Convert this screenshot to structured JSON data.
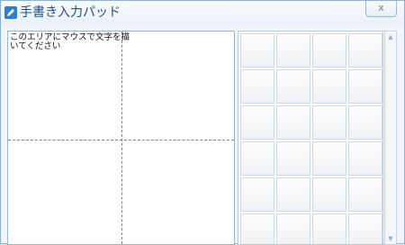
{
  "window": {
    "title": "手書き入力パッド",
    "close_label": "x",
    "icon": "pen-icon"
  },
  "draw_area": {
    "prompt": "このエリアにマウスで文字を描いてください"
  },
  "candidates": {
    "columns": 4,
    "rows": 6
  },
  "scrollbar": {
    "up_icon": "▲",
    "down_icon": "▼"
  }
}
